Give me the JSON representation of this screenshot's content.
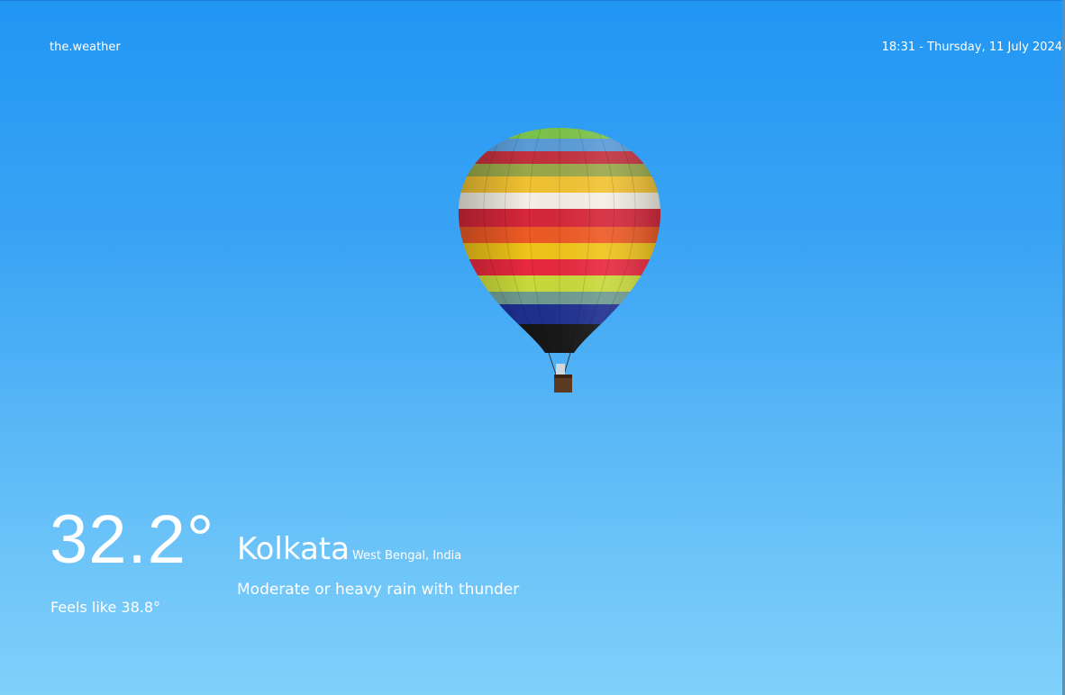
{
  "header": {
    "brand": "the.weather",
    "datetime": "18:31 - Thursday, 11 July 2024"
  },
  "weather": {
    "temperature": "32.2°",
    "feels_like": "Feels like 38.8°",
    "city": "Kolkata",
    "region": "West Bengal, India",
    "condition": "Moderate or heavy rain with thunder"
  },
  "background": {
    "image": "hot-air-balloon-icon",
    "sky_top": "#2196f3",
    "sky_bottom": "#80d1fa"
  }
}
